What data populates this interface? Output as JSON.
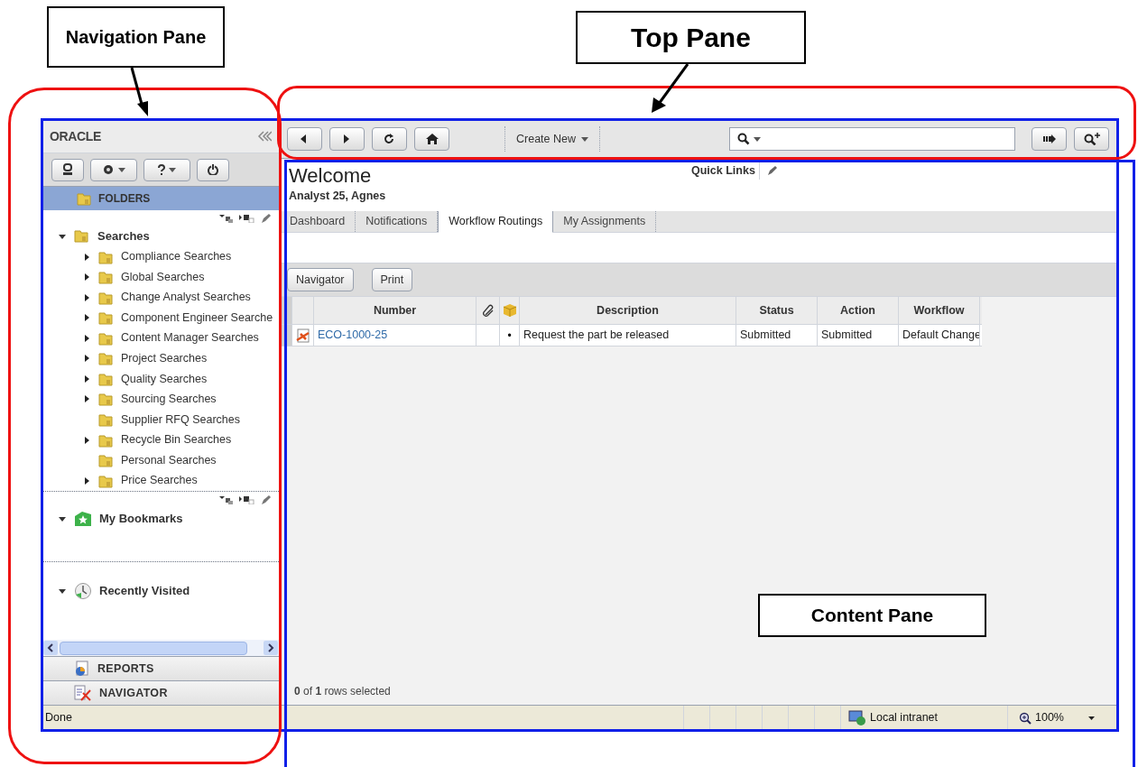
{
  "annotations": [
    {
      "kind": "callout",
      "label": "Navigation Pane"
    },
    {
      "kind": "callout",
      "label": "Top Pane"
    },
    {
      "kind": "callout",
      "label": "Content Pane"
    }
  ],
  "navigation": {
    "logo": "ORACLE",
    "folders_label": "FOLDERS",
    "tree": [
      {
        "label": "Searches",
        "expanded": true,
        "children": [
          {
            "label": "Compliance Searches",
            "expandable": true
          },
          {
            "label": "Global Searches",
            "expandable": true
          },
          {
            "label": "Change Analyst Searches",
            "expandable": true
          },
          {
            "label": "Component Engineer Searche",
            "expandable": true
          },
          {
            "label": "Content Manager Searches",
            "expandable": true
          },
          {
            "label": "Project Searches",
            "expandable": true
          },
          {
            "label": "Quality Searches",
            "expandable": true
          },
          {
            "label": "Sourcing Searches",
            "expandable": true
          },
          {
            "label": "Supplier RFQ Searches",
            "expandable": false
          },
          {
            "label": "Recycle Bin Searches",
            "expandable": true
          },
          {
            "label": "Personal Searches",
            "expandable": false
          },
          {
            "label": "Price Searches",
            "expandable": true
          }
        ]
      }
    ],
    "bookmarks": {
      "label": "My Bookmarks",
      "expanded": true
    },
    "recent": {
      "label": "Recently Visited",
      "expanded": true
    },
    "bottom_sections": [
      {
        "kind": "reports",
        "label": "REPORTS"
      },
      {
        "kind": "navigator",
        "label": "NAVIGATOR"
      }
    ]
  },
  "toolbar": {
    "create_new": "Create New"
  },
  "content": {
    "title": "Welcome",
    "user": "Analyst 25, Agnes",
    "quick_links": "Quick Links",
    "tabs": [
      {
        "label": "Dashboard",
        "selected": false
      },
      {
        "label": "Notifications",
        "selected": false
      },
      {
        "label": "Workflow Routings",
        "selected": true
      },
      {
        "label": "My Assignments",
        "selected": false
      }
    ],
    "buttons": [
      "Navigator",
      "Print"
    ],
    "table": {
      "columns": [
        "Number",
        "Description",
        "Status",
        "Action",
        "Workflow"
      ],
      "rows": [
        {
          "number": "ECO-1000-25",
          "attachment_dot": "•",
          "description": "Request the part be released",
          "status": "Submitted",
          "action": "Submitted",
          "workflow": "Default Change"
        }
      ]
    },
    "selection": "**0** of **1** rows selected"
  },
  "status_bar": {
    "text": "Done",
    "zone": "Local intranet",
    "zoom": "100%"
  }
}
